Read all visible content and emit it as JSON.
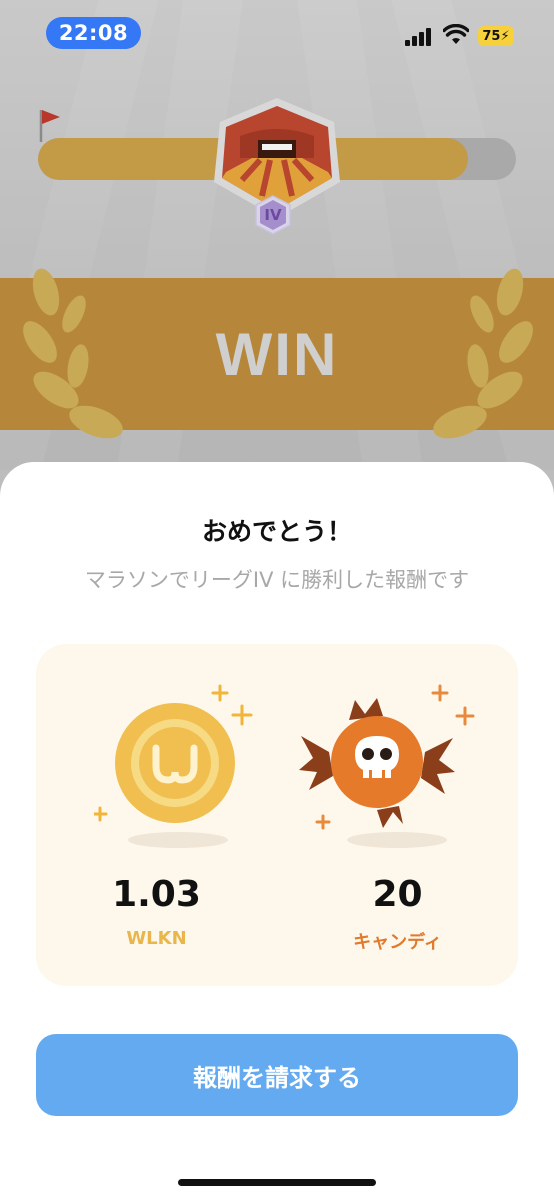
{
  "status_bar": {
    "time": "22:08",
    "battery": "75"
  },
  "header": {
    "progress_fraction": 0.9,
    "level_badge": "IV"
  },
  "banner": {
    "text": "WIN"
  },
  "sheet": {
    "title": "おめでとう！",
    "subtitle": "マラソンでリーグIV に勝利した報酬です",
    "rewards": [
      {
        "amount": "1.03",
        "unit": "WLKN",
        "icon": "wlkn-coin-icon",
        "color": "#e8b64a"
      },
      {
        "amount": "20",
        "unit": "キャンディ",
        "icon": "candy-icon",
        "color": "#e07a2c"
      }
    ],
    "claim_label": "報酬を請求する"
  },
  "colors": {
    "accent": "#64aaf0",
    "banner": "#b6873a",
    "progress": "#c39a45"
  }
}
